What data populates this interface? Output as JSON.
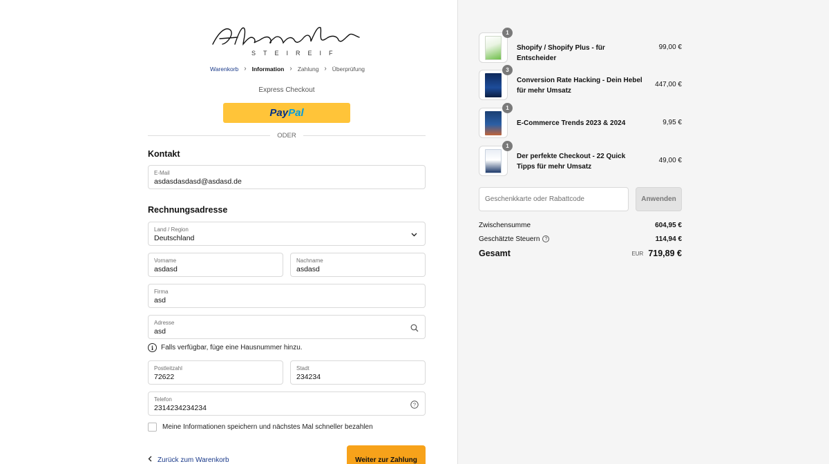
{
  "brand": {
    "logo_script": "Alexander",
    "logo_sub": "STEIREIF"
  },
  "breadcrumb": {
    "items": [
      {
        "label": "Warenkorb",
        "state": "link"
      },
      {
        "label": "Information",
        "state": "active"
      },
      {
        "label": "Zahlung",
        "state": "inactive"
      },
      {
        "label": "Überprüfung",
        "state": "inactive"
      }
    ]
  },
  "express": {
    "label": "Express Checkout",
    "paypal_part1": "Pay",
    "paypal_part2": "Pal",
    "divider": "ODER"
  },
  "contact": {
    "title": "Kontakt",
    "email_label": "E-Mail",
    "email_value": "asdasdasdasd@asdasd.de"
  },
  "billing": {
    "title": "Rechnungsadresse",
    "country_label": "Land / Region",
    "country_value": "Deutschland",
    "firstname_label": "Vorname",
    "firstname_value": "asdasd",
    "lastname_label": "Nachname",
    "lastname_value": "asdasd",
    "company_label": "Firma",
    "company_value": "asd",
    "address_label": "Adresse",
    "address_value": "asd",
    "address_hint": "Falls verfügbar, füge eine Hausnummer hinzu.",
    "zip_label": "Postleitzahl",
    "zip_value": "72622",
    "city_label": "Stadt",
    "city_value": "234234",
    "phone_label": "Telefon",
    "phone_value": "2314234234234"
  },
  "remember": {
    "label": "Meine Informationen speichern und nächstes Mal schneller bezahlen"
  },
  "actions": {
    "back_label": "Zurück zum Warenkorb",
    "continue_label": "Weiter zur Zahlung"
  },
  "cart": {
    "items": [
      {
        "name": "Shopify / Shopify Plus - für Entscheider",
        "qty": "1",
        "price": "99,00 €",
        "cover_color": "#6fbf4a"
      },
      {
        "name": "Conversion Rate Hacking - Dein Hebel für mehr Umsatz",
        "qty": "3",
        "price": "447,00 €",
        "cover_color": "#0f2a5c"
      },
      {
        "name": "E-Commerce Trends 2023 & 2024",
        "qty": "1",
        "price": "9,95 €",
        "cover_color": "#1b3f73"
      },
      {
        "name": "Der perfekte Checkout - 22 Quick Tipps für mehr Umsatz",
        "qty": "1",
        "price": "49,00 €",
        "cover_color": "#e9eef5"
      }
    ],
    "gift_placeholder": "Geschenkkarte oder Rabattcode",
    "apply_label": "Anwenden"
  },
  "summary": {
    "subtotal_label": "Zwischensumme",
    "subtotal_value": "604,95 €",
    "tax_label": "Geschätzte Steuern",
    "tax_value": "114,94 €",
    "total_label": "Gesamt",
    "total_currency": "EUR",
    "total_value": "719,89 €"
  }
}
